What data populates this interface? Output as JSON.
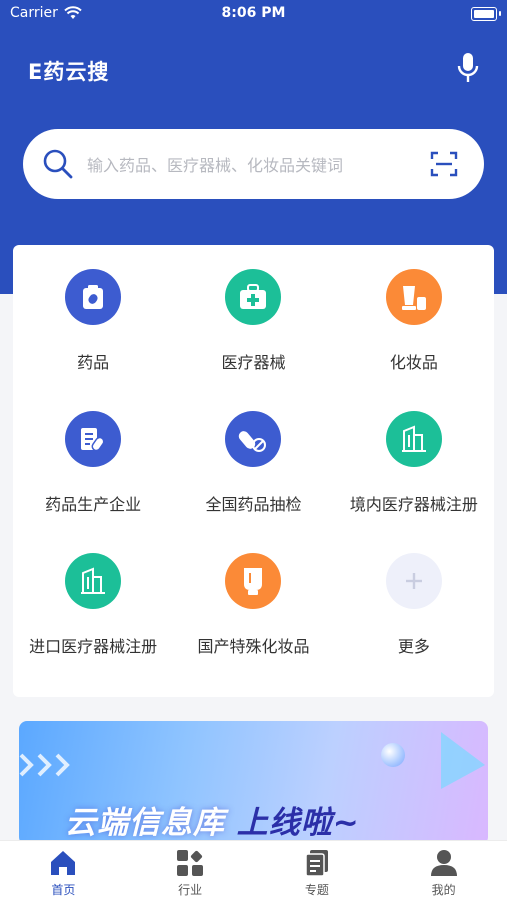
{
  "status_bar": {
    "carrier": "Carrier",
    "time": "8:06 PM"
  },
  "header": {
    "logo_text": "E药云搜",
    "mic_icon": "microphone-icon"
  },
  "search": {
    "placeholder": "输入药品、医疗器械、化妆品关键词",
    "search_icon": "search-icon",
    "scan_icon": "scan-icon"
  },
  "categories": [
    {
      "label": "药品",
      "icon": "medicine-box-icon",
      "color": "#3d5cd0"
    },
    {
      "label": "医疗器械",
      "icon": "medical-kit-icon",
      "color": "#1cbf98"
    },
    {
      "label": "化妆品",
      "icon": "cosmetics-icon",
      "color": "#fb8a37"
    },
    {
      "label": "药品生产企业",
      "icon": "pharma-factory-icon",
      "color": "#3d5cd0"
    },
    {
      "label": "全国药品抽检",
      "icon": "pill-capsule-icon",
      "color": "#3d5cd0"
    },
    {
      "label": "境内医疗器械注册",
      "icon": "building-icon",
      "color": "#1cbf98"
    },
    {
      "label": "进口医疗器械注册",
      "icon": "building-icon",
      "color": "#1cbf98"
    },
    {
      "label": "国产特殊化妆品",
      "icon": "cosmetic-tube-icon",
      "color": "#fb8a37"
    },
    {
      "label": "更多",
      "icon": "plus-icon",
      "color": "#eef0fa"
    }
  ],
  "banner": {
    "text_main": "云端信息库",
    "text_tail": "上线啦~"
  },
  "tabbar": {
    "items": [
      {
        "label": "首页",
        "icon": "home-icon",
        "active": true
      },
      {
        "label": "行业",
        "icon": "grid-apps-icon",
        "active": false
      },
      {
        "label": "专题",
        "icon": "document-icon",
        "active": false
      },
      {
        "label": "我的",
        "icon": "user-icon",
        "active": false
      }
    ]
  },
  "colors": {
    "brand": "#2a4fbd",
    "page_bg": "#f4f5f8",
    "active_tab": "#2a4fbd"
  }
}
